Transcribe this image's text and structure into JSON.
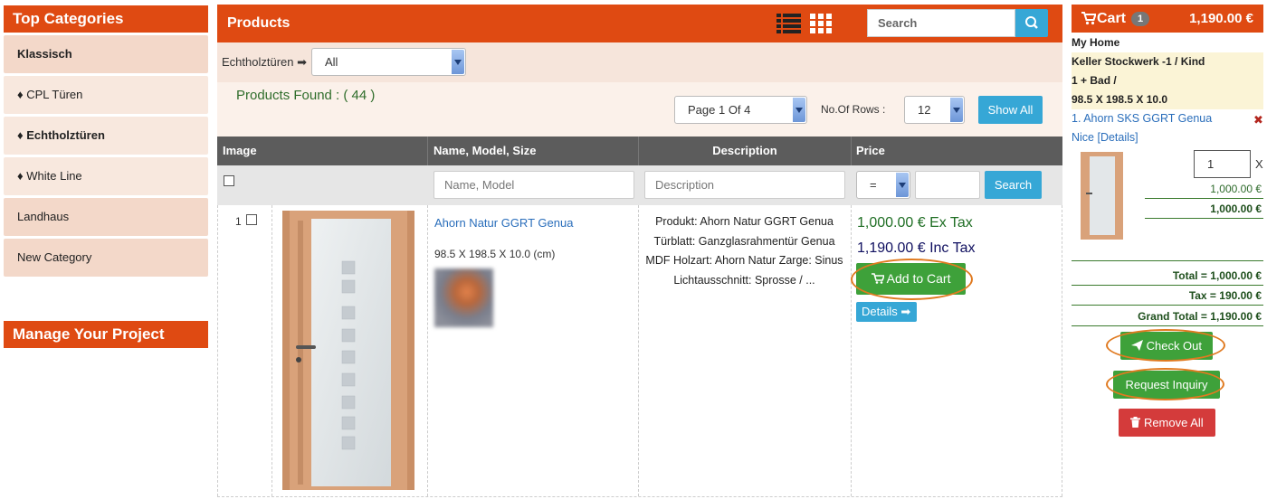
{
  "sidebar": {
    "title": "Top Categories",
    "items": [
      {
        "label": "Klassisch"
      },
      {
        "label": "♦ CPL Türen"
      },
      {
        "label": "♦ Echtholztüren"
      },
      {
        "label": "♦ White Line"
      },
      {
        "label": "Landhaus"
      },
      {
        "label": "New Category"
      }
    ],
    "manage_title": "Manage Your Project"
  },
  "products": {
    "title": "Products",
    "search_placeholder": "Search",
    "filter_label": "Echtholztüren",
    "filter_value": "All",
    "found_text": "Products Found : ( 44 )",
    "page_select": "Page 1 Of 4",
    "rows_label": "No.Of Rows  :",
    "rows_value": "12",
    "show_all": "Show All"
  },
  "table": {
    "headers": [
      "Image",
      "Name, Model, Size",
      "Description",
      "Price"
    ],
    "name_placeholder": "Name, Model",
    "desc_placeholder": "Description",
    "operator": "=",
    "search_label": "Search"
  },
  "row": {
    "index": "1",
    "name": "Ahorn Natur GGRT Genua",
    "size": "98.5 X 198.5 X 10.0 (cm)",
    "desc_lines": [
      "Produkt: Ahorn Natur GGRT Genua",
      "Türblatt: Ganzglasrahmentür Genua",
      "MDF Holzart: Ahorn Natur Zarge: Sinus",
      "Lichtausschnitt: Sprosse / ..."
    ],
    "price_ex": "1,000.00 € Ex Tax",
    "price_inc": "1,190.00 € Inc Tax",
    "add_to_cart": "Add to Cart",
    "details": "Details"
  },
  "cart": {
    "title": "Cart",
    "count": "1",
    "total": "1,190.00 €",
    "crumbs": [
      "My Home",
      "Keller Stockwerk -1 / Kind",
      "1 + Bad /",
      "98.5 X 198.5 X 10.0"
    ],
    "item_name": "1. Ahorn SKS GGRT Genua",
    "item_link": "Nice [Details]",
    "qty": "1",
    "x_mark": "X",
    "unit_price": "1,000.00 €",
    "line_total": "1,000.00 €",
    "total_line": "Total = 1,000.00 €",
    "tax_line": "Tax = 190.00 €",
    "grand_total_line": "Grand Total = 1,190.00 €",
    "checkout": "Check Out",
    "inquiry": "Request Inquiry",
    "remove_all": "Remove All"
  },
  "colors": {
    "brand": "#df4a12",
    "accent_blue": "#36a7d6",
    "accent_green": "#3ea13a",
    "danger": "#d43b3b",
    "highlight_ring": "#e07a20"
  },
  "icons": [
    "list-view-icon",
    "grid-view-icon",
    "search-icon",
    "arrow-right-icon",
    "cart-icon",
    "send-icon",
    "trash-icon",
    "remove-icon"
  ]
}
